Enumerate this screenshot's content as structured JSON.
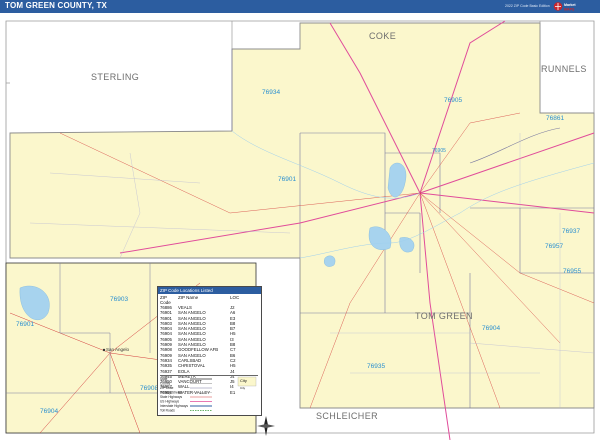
{
  "header": {
    "title": "TOM GREEN COUNTY, TX",
    "edition": "2022 ZIP Code Basic Edition",
    "logo_text": "MARKET MAPS",
    "brand_color": "#2c5da0"
  },
  "colors": {
    "county_fill": "#fbf7cc",
    "neighbor_fill": "#ffffff",
    "neighbor_edge": "#8c8c8c",
    "zip_boundary": "#7a7aa0",
    "highway": "#e04c9a",
    "road": "#d33a3a",
    "water": "#a7d3ee",
    "zip_label": "#2a8fd0",
    "county_label": "#6e6e6e"
  },
  "map": {
    "counties": [
      "COKE",
      "STERLING",
      "RUNNELS",
      "TOM GREEN",
      "SCHLEICHER"
    ],
    "zip_labels": [
      "76934",
      "76905",
      "76901",
      "76861",
      "76905",
      "76937",
      "76957",
      "76955",
      "76904",
      "76935"
    ],
    "inset_zip_labels": [
      "76903",
      "76901",
      "76908",
      "76904"
    ],
    "inset_places": [
      "San Angelo"
    ]
  },
  "legend": {
    "title": "ZIP Code Locations Listed",
    "columns": [
      "ZIP Code",
      "ZIP Name",
      "LOC"
    ],
    "rows": [
      [
        "76886",
        "VEALS",
        "J2"
      ],
      [
        "76901",
        "SAN ANGELO",
        "A6"
      ],
      [
        "76901",
        "SAN ANGELO",
        "E3"
      ],
      [
        "76903",
        "SAN ANGELO",
        "B8"
      ],
      [
        "76904",
        "SAN ANGELO",
        "B7"
      ],
      [
        "76904",
        "SAN ANGELO",
        "H5"
      ],
      [
        "76905",
        "SAN ANGELO",
        "I3"
      ],
      [
        "76909",
        "SAN ANGELO",
        "B8"
      ],
      [
        "76908",
        "GOODFELLOW AFB",
        "C7"
      ],
      [
        "76909",
        "SAN ANGELO",
        "B6"
      ],
      [
        "76934",
        "CARLSBAD",
        "C2"
      ],
      [
        "76935",
        "CHRISTOVAL",
        "H5"
      ],
      [
        "76937",
        "EOLA",
        "J4"
      ],
      [
        "76945",
        "MERETA",
        "J4"
      ],
      [
        "76950",
        "VANCOURT",
        "J5"
      ],
      [
        "76957",
        "WALL",
        "I4"
      ],
      [
        "76958",
        "WATER VALLEY",
        "E1"
      ]
    ],
    "key": [
      {
        "label": "State",
        "kind": "state"
      },
      {
        "label": "County",
        "kind": "county"
      },
      {
        "label": "ZIP Code",
        "kind": "zip"
      },
      {
        "label": "Primary Streets",
        "kind": "street"
      },
      {
        "label": "State Highways",
        "kind": "statehwy"
      },
      {
        "label": "US Highways",
        "kind": "ushwy"
      },
      {
        "label": "Interstate Highways",
        "kind": "interstate"
      },
      {
        "label": "Toll Roads",
        "kind": "toll"
      }
    ],
    "city_key": [
      "City",
      "City"
    ]
  }
}
